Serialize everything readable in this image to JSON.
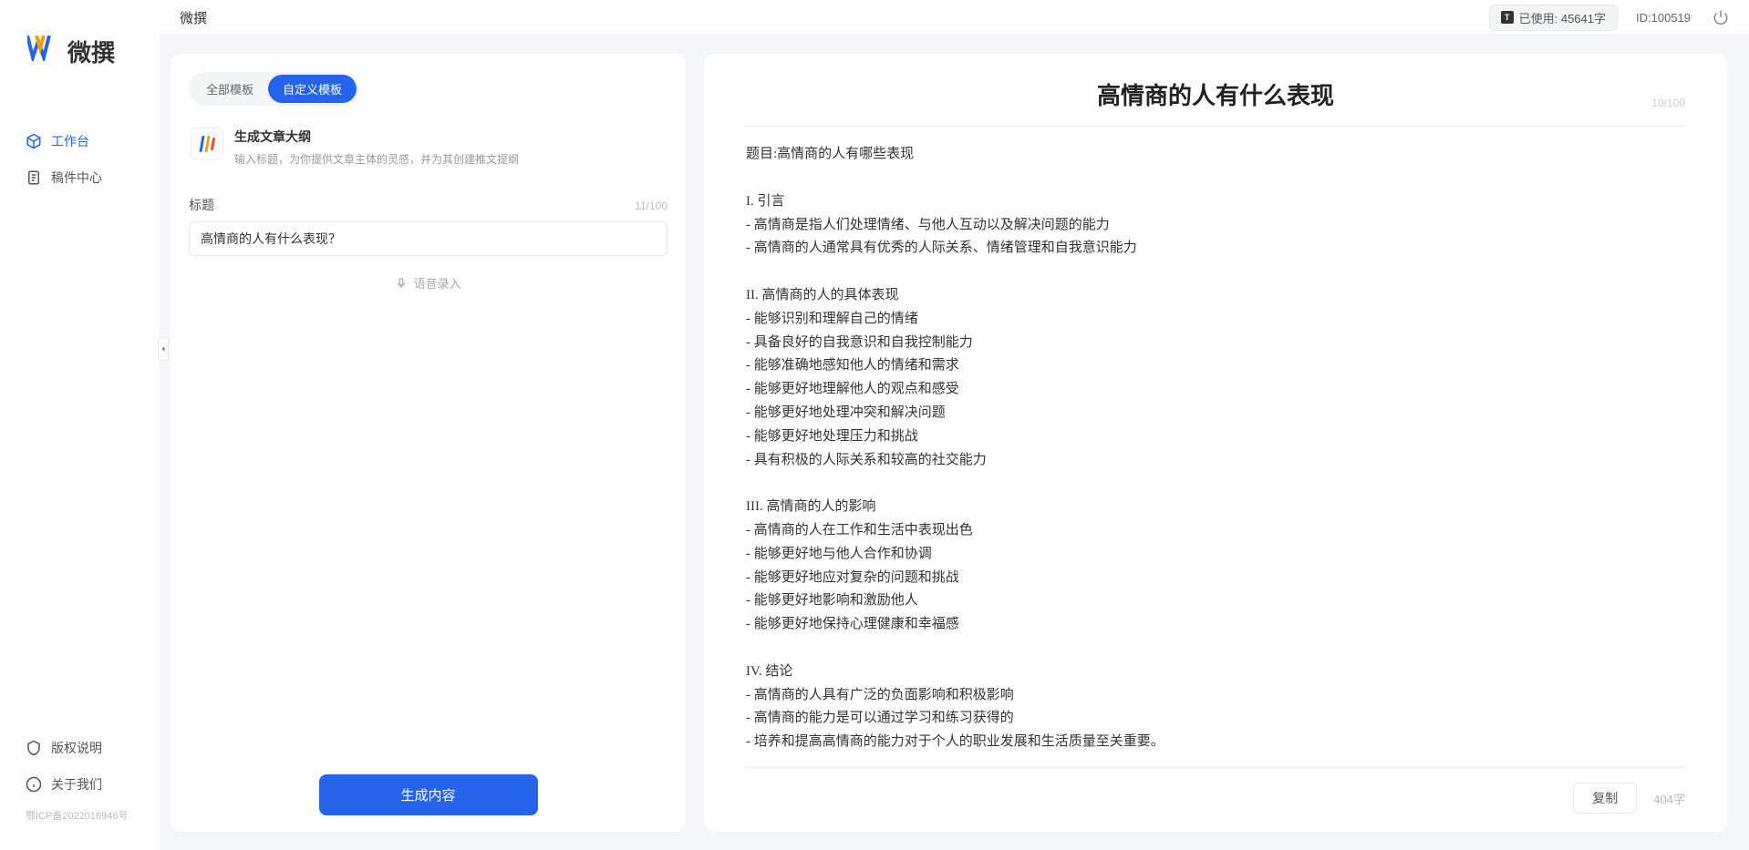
{
  "brand": {
    "name": "微撰"
  },
  "sidebar": {
    "items": [
      {
        "label": "工作台",
        "active": true
      },
      {
        "label": "稿件中心",
        "active": false
      }
    ],
    "footer": [
      {
        "label": "版权说明"
      },
      {
        "label": "关于我们"
      }
    ],
    "icp": "鄂ICP备2022016946号"
  },
  "topbar": {
    "title": "微撰",
    "usage_label": "已使用:  45641字",
    "user_id_label": "ID:100519"
  },
  "left": {
    "tabs": [
      {
        "label": "全部模板",
        "active": false
      },
      {
        "label": "自定义模板",
        "active": true
      }
    ],
    "template": {
      "title": "生成文章大纲",
      "desc": "输入标题，为你提供文章主体的灵感，并为其创建推文提纲"
    },
    "title_field": {
      "label": "标题",
      "value": "高情商的人有什么表现？",
      "count": "11/100"
    },
    "voice_label": "语音录入",
    "generate_label": "生成内容"
  },
  "right": {
    "title": "高情商的人有什么表现",
    "title_count": "10/100",
    "body": "题目:高情商的人有哪些表现\n\nI. 引言\n- 高情商是指人们处理情绪、与他人互动以及解决问题的能力\n- 高情商的人通常具有优秀的人际关系、情绪管理和自我意识能力\n\nII. 高情商的人的具体表现\n- 能够识别和理解自己的情绪\n- 具备良好的自我意识和自我控制能力\n- 能够准确地感知他人的情绪和需求\n- 能够更好地理解他人的观点和感受\n- 能够更好地处理冲突和解决问题\n- 能够更好地处理压力和挑战\n- 具有积极的人际关系和较高的社交能力\n\nIII. 高情商的人的影响\n- 高情商的人在工作和生活中表现出色\n- 能够更好地与他人合作和协调\n- 能够更好地应对复杂的问题和挑战\n- 能够更好地影响和激励他人\n- 能够更好地保持心理健康和幸福感\n\nIV. 结论\n- 高情商的人具有广泛的负面影响和积极影响\n- 高情商的能力是可以通过学习和练习获得的\n- 培养和提高高情商的能力对于个人的职业发展和生活质量至关重要。",
    "copy_label": "复制",
    "word_count": "404字"
  }
}
